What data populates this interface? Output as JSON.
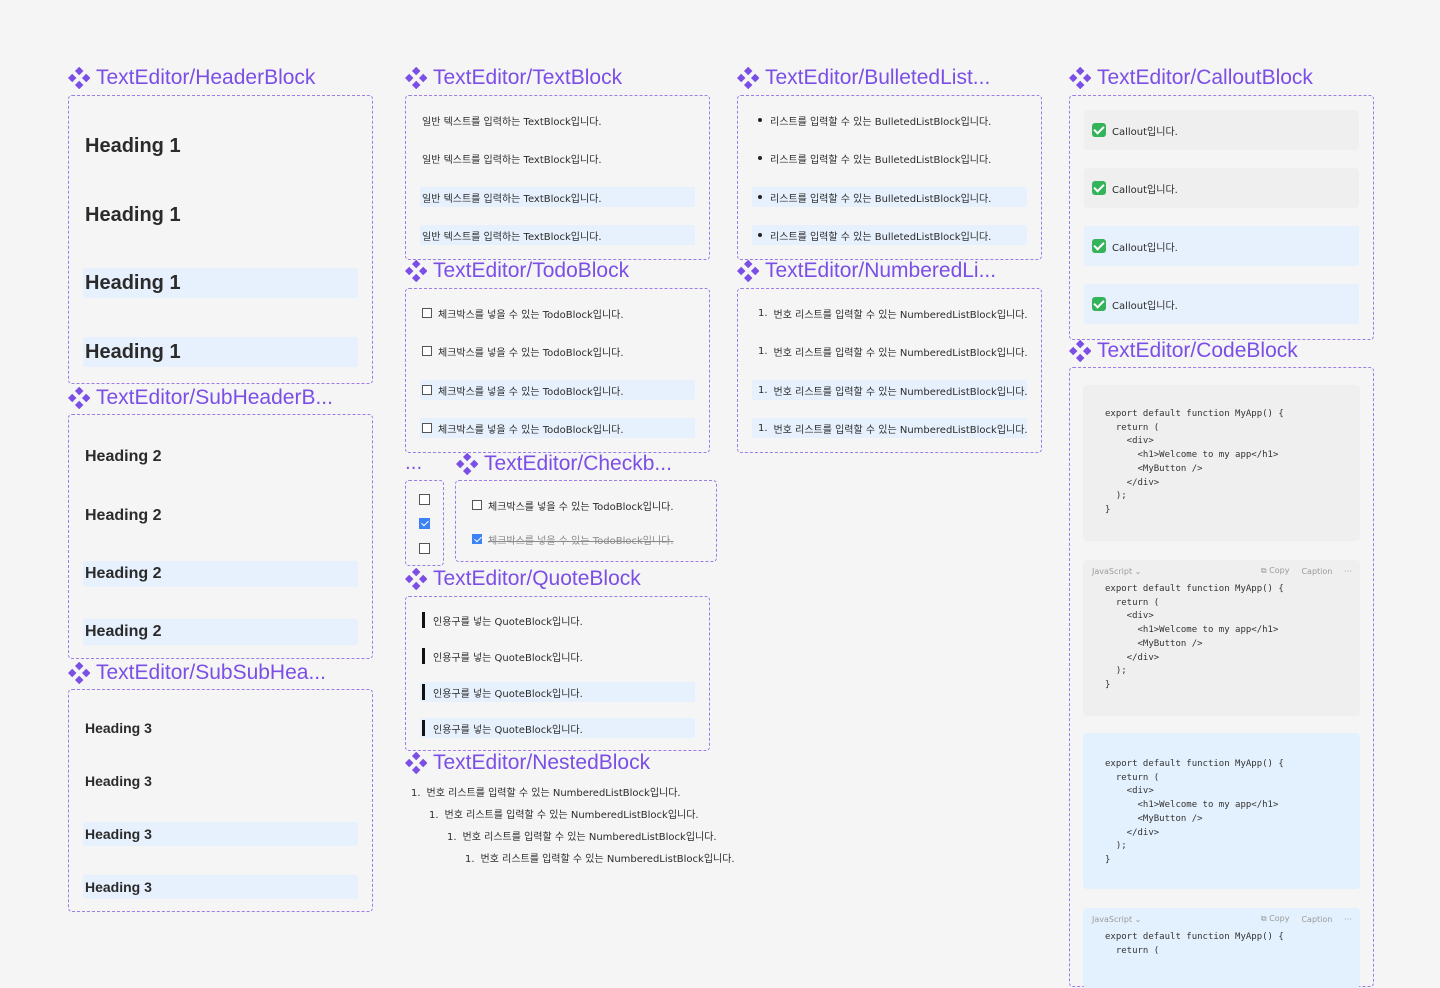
{
  "components": {
    "header_block": {
      "title": "TextEditor/HeaderBlock",
      "rows": [
        "Heading 1",
        "Heading 1",
        "Heading 1",
        "Heading 1"
      ]
    },
    "subheader_block": {
      "title": "TextEditor/SubHeaderB...",
      "rows": [
        "Heading 2",
        "Heading 2",
        "Heading 2",
        "Heading 2"
      ]
    },
    "subsubheader_block": {
      "title": "TextEditor/SubSubHea...",
      "rows": [
        "Heading 3",
        "Heading 3",
        "Heading 3",
        "Heading 3"
      ]
    },
    "text_block": {
      "title": "TextEditor/TextBlock",
      "rows": [
        "일반 텍스트를 입력하는 TextBlock입니다.",
        "일반 텍스트를 입력하는 TextBlock입니다.",
        "일반 텍스트를 입력하는 TextBlock입니다.",
        "일반 텍스트를 입력하는 TextBlock입니다."
      ]
    },
    "todo_block": {
      "title": "TextEditor/TodoBlock",
      "rows": [
        "체크박스를 넣을 수 있는 TodoBlock입니다.",
        "체크박스를 넣을 수 있는 TodoBlock입니다.",
        "체크박스를 넣을 수 있는 TodoBlock입니다.",
        "체크박스를 넣을 수 있는 TodoBlock입니다."
      ]
    },
    "checkbox": {
      "ellipsis": "...",
      "title": "TextEditor/Checkb...",
      "items": [
        {
          "label": "체크박스를 넣을 수 있는 TodoBlock입니다.",
          "checked": false
        },
        {
          "label": "체크박스를 넣을 수 있는 TodoBlock입니다.",
          "checked": true
        }
      ],
      "mini_states": [
        false,
        true,
        false
      ]
    },
    "quote_block": {
      "title": "TextEditor/QuoteBlock",
      "rows": [
        "인용구를 넣는 QuoteBlock입니다.",
        "인용구를 넣는 QuoteBlock입니다.",
        "인용구를 넣는 QuoteBlock입니다.",
        "인용구를 넣는 QuoteBlock입니다."
      ]
    },
    "nested_block": {
      "title": "TextEditor/NestedBlock",
      "rows": [
        {
          "num": "1.",
          "text": "번호 리스트를 입력할 수 있는 NumberedListBlock입니다."
        },
        {
          "num": "1.",
          "text": "번호 리스트를 입력할 수 있는 NumberedListBlock입니다."
        },
        {
          "num": "1.",
          "text": "번호 리스트를 입력할 수 있는 NumberedListBlock입니다."
        },
        {
          "num": "1.",
          "text": "번호 리스트를 입력할 수 있는 NumberedListBlock입니다."
        }
      ]
    },
    "bulleted_list": {
      "title": "TextEditor/BulletedList...",
      "rows": [
        "리스트를 입력할 수 있는 BulletedListBlock입니다.",
        "리스트를 입력할 수 있는 BulletedListBlock입니다.",
        "리스트를 입력할 수 있는 BulletedListBlock입니다.",
        "리스트를 입력할 수 있는 BulletedListBlock입니다."
      ]
    },
    "numbered_list": {
      "title": "TextEditor/NumberedLi...",
      "rows": [
        {
          "num": "1.",
          "text": "번호 리스트를 입력할 수 있는 NumberedListBlock입니다."
        },
        {
          "num": "1.",
          "text": "번호 리스트를 입력할 수 있는 NumberedListBlock입니다."
        },
        {
          "num": "1.",
          "text": "번호 리스트를 입력할 수 있는 NumberedListBlock입니다."
        },
        {
          "num": "1.",
          "text": "번호 리스트를 입력할 수 있는 NumberedListBlock입니다."
        }
      ]
    },
    "callout_block": {
      "title": "TextEditor/CalloutBlock",
      "rows": [
        "Callout입니다.",
        "Callout입니다.",
        "Callout입니다.",
        "Callout입니다."
      ]
    },
    "code_block": {
      "title": "TextEditor/CodeBlock",
      "code": "export default function MyApp() {\n  return (\n    <div>\n      <h1>Welcome to my app</h1>\n      <MyButton />\n    </div>\n  );\n}",
      "code_partial": "export default function MyApp() {\n  return (",
      "toolbar": {
        "language": "JavaScript ⌄",
        "copy": "⧉ Copy",
        "caption": "Caption",
        "more": "···"
      }
    }
  },
  "colors": {
    "accent": "#7b4ee6",
    "frame_border": "#9b7ce8",
    "highlight": "#e7f1fd",
    "background": "#f5f5f5"
  },
  "icons": {
    "component": "component-diamond-icon",
    "grip": "drag-grip-icon",
    "checkbox": "checkbox-icon",
    "callout": "check-mark-button-icon",
    "copy": "copy-icon"
  }
}
